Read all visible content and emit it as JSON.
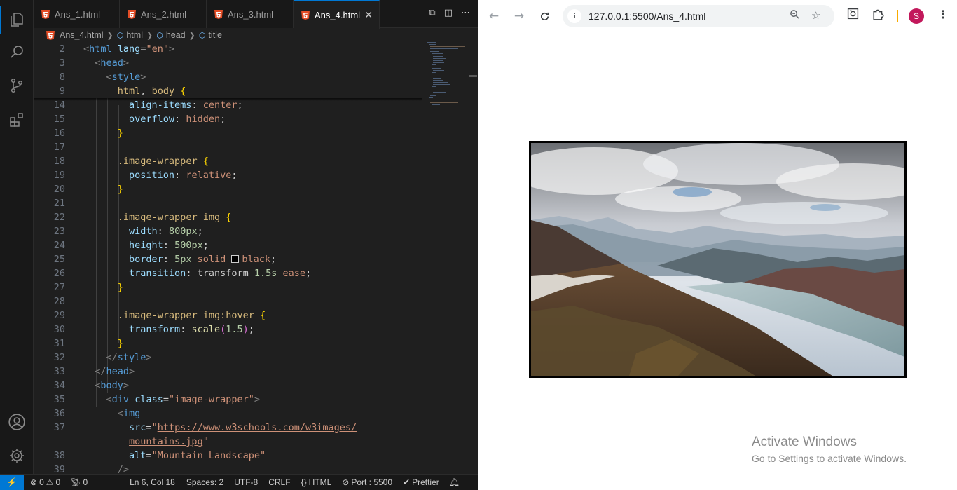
{
  "editor": {
    "tabs": [
      {
        "label": "Ans_1.html"
      },
      {
        "label": "Ans_2.html"
      },
      {
        "label": "Ans_3.html"
      },
      {
        "label": "Ans_4.html",
        "active": true
      }
    ],
    "tab_close_glyph": "✕",
    "tab_actions": [
      "⧉",
      "◫",
      "⋯"
    ],
    "breadcrumb": [
      "Ans_4.html",
      "html",
      "head",
      "title"
    ],
    "line_numbers": {
      "l2": "2",
      "l3": "3",
      "l8": "8",
      "l9": "9",
      "l14": "14",
      "l15": "15",
      "l16": "16",
      "l17": "17",
      "l18": "18",
      "l19": "19",
      "l20": "20",
      "l21": "21",
      "l22": "22",
      "l23": "23",
      "l24": "24",
      "l25": "25",
      "l26": "26",
      "l27": "27",
      "l28": "28",
      "l29": "29",
      "l30": "30",
      "l31": "31",
      "l32": "32",
      "l33": "33",
      "l34": "34",
      "l35": "35",
      "l36": "36",
      "l37": "37",
      "l38": "38",
      "l39": "39"
    },
    "tokens": {
      "lt": "<",
      "gt": ">",
      "lt_slash": "</",
      "slash_gt": "/>",
      "eq": "=",
      "q": "\"",
      "colon": ":",
      "semi": ";",
      "comma": ",",
      "lbrace": "{",
      "rbrace": "}",
      "lparen": "(",
      "rparen": ")",
      "html": "html",
      "lang": "lang",
      "en": "en",
      "head": "head",
      "style": "style",
      "body": "body",
      "div": "div",
      "class": "class",
      "image_wrapper": "image-wrapper",
      "img": "img",
      "src": "src",
      "alt": "alt",
      "sel_html_body_1": "html",
      "sel_html_body_2": "body",
      "align_items": "align-items",
      "center": "center",
      "overflow": "overflow",
      "hidden": "hidden",
      "sel_image_wrapper": ".image-wrapper",
      "position": "position",
      "relative": "relative",
      "sel_image_wrapper_img": ".image-wrapper img",
      "width": "width",
      "px800": "800px",
      "height": "height",
      "px500": "500px",
      "border": "border",
      "px5": "5px",
      "solid": "solid",
      "black": "black",
      "transition": "transition",
      "transform": "transform",
      "s15": "1.5s",
      "ease": "ease",
      "sel_hover": ".image-wrapper img:hover",
      "scale": "scale",
      "n15": "1.5",
      "url1": "https://www.w3schools.com/w3images/",
      "url2": "mountains.jpg",
      "alt_value": "Mountain Landscape"
    },
    "status": {
      "remote_glyph": "⚡",
      "errors": "0",
      "warnings": "0",
      "ports": "0",
      "position": "Ln 6, Col 18",
      "spaces": "Spaces: 2",
      "encoding": "UTF-8",
      "eol": "CRLF",
      "language": "HTML",
      "port": "Port : 5500",
      "formatter": "Prettier"
    }
  },
  "browser": {
    "url": "127.0.0.1:5500/Ans_4.html",
    "avatar_letter": "S",
    "image_alt": "Mountain Landscape",
    "watermark_title": "Activate Windows",
    "watermark_subtitle": "Go to Settings to activate Windows."
  },
  "colors": {
    "accent": "#0078d4",
    "avatar": "#c2185b"
  }
}
